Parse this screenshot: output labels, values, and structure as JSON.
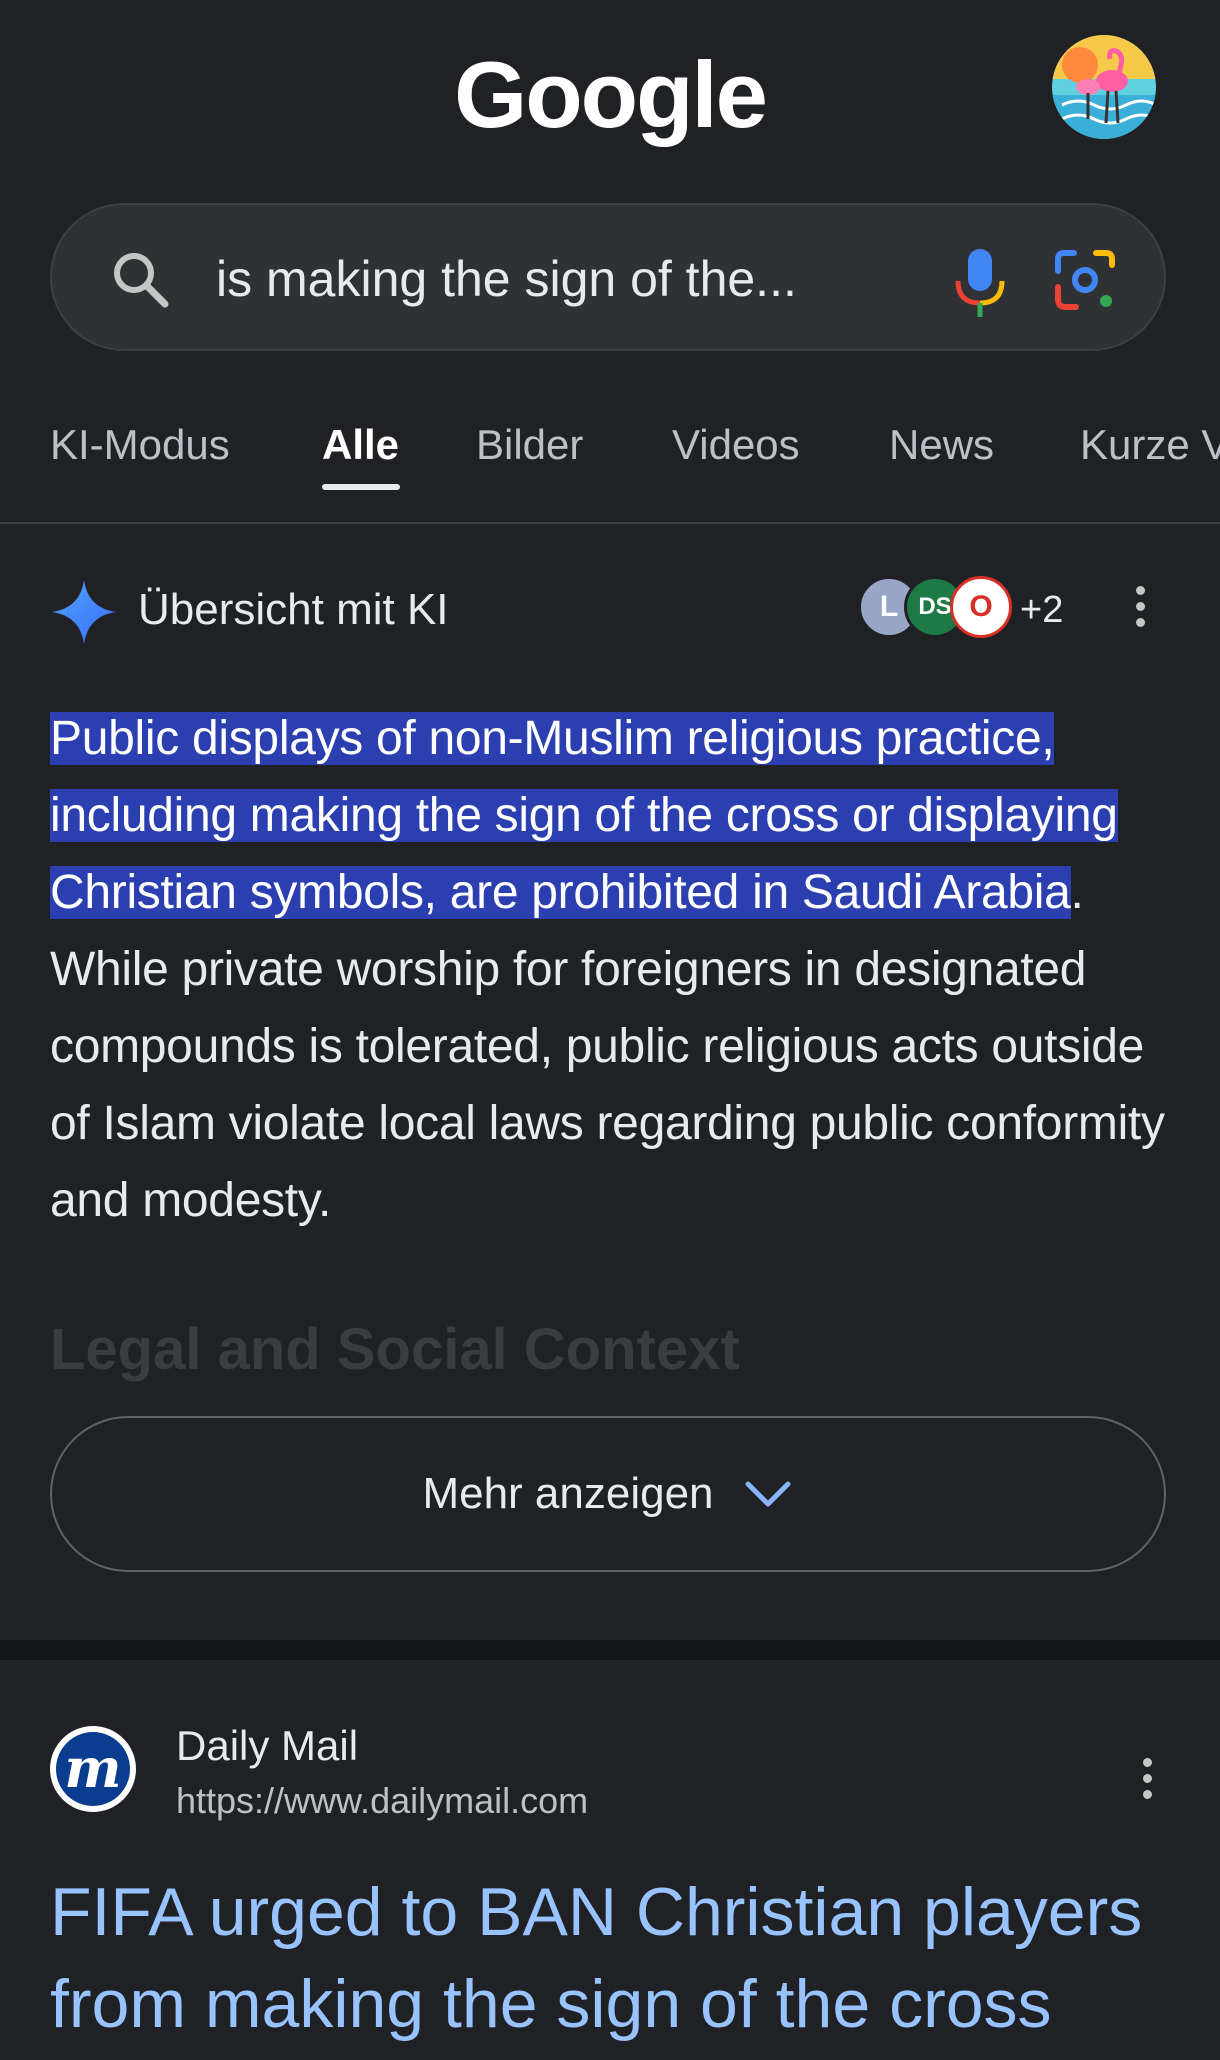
{
  "header": {
    "logo_text": "Google"
  },
  "search": {
    "query": "is making the sign of the..."
  },
  "tabs": [
    {
      "label": "KI-Modus",
      "active": false
    },
    {
      "label": "Alle",
      "active": true
    },
    {
      "label": "Bilder",
      "active": false
    },
    {
      "label": "Videos",
      "active": false
    },
    {
      "label": "News",
      "active": false
    },
    {
      "label": "Kurze V",
      "active": false
    }
  ],
  "ai_overview": {
    "title": "Übersicht mit KI",
    "sources": [
      {
        "letter": "L",
        "color": "#9aa6c8"
      },
      {
        "letter": "DS",
        "color": "#1e7a45"
      },
      {
        "letter": "O",
        "color": "#d93025"
      }
    ],
    "sources_more": "+2",
    "highlighted_text": "Public displays of non-Muslim religious practice, including making the sign of the cross or displaying Christian symbols, are prohibited in Saudi Arabia",
    "body_text": ". While private worship for foreigners in designated compounds is tolerated, public religious acts outside of Islam violate local laws regarding public conformity and modesty.",
    "faded_heading": "Legal and Social Context",
    "more_button": "Mehr anzeigen"
  },
  "result": {
    "site_name": "Daily Mail",
    "url": "https://www.dailymail.com",
    "favicon_letter": "m",
    "title": "FIFA urged to BAN Christian players from making the sign of the cross"
  },
  "colors": {
    "background": "#1f2125",
    "highlight": "#2c3fb0",
    "link": "#99c3ff"
  }
}
